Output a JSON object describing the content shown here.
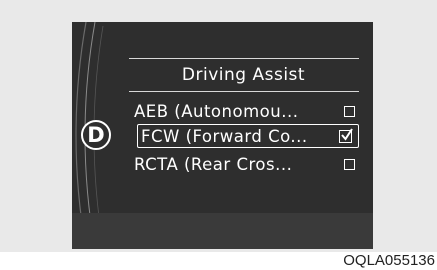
{
  "screen": {
    "gear_indicator": "D",
    "menu_title": "Driving Assist",
    "items": [
      {
        "label": "AEB (Autonomou...",
        "checked": false,
        "selected": false
      },
      {
        "label": "FCW (Forward Co...",
        "checked": true,
        "selected": true
      },
      {
        "label": "RCTA (Rear Cros...",
        "checked": false,
        "selected": false
      }
    ]
  },
  "caption": "OQLA055136",
  "colors": {
    "screen_bg": "#2e2e2e",
    "text": "#ffffff",
    "frame_bg": "#e9e9e9"
  }
}
